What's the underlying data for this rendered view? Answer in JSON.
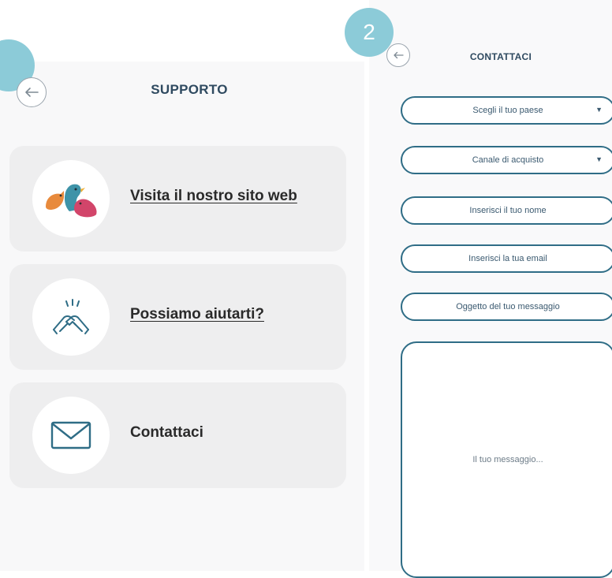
{
  "steps": {
    "step2": "2"
  },
  "support_screen": {
    "title": "SUPPORTO",
    "cards": [
      {
        "label": "Visita il nostro sito web",
        "icon": "birds-logo-icon"
      },
      {
        "label": "Possiamo aiutarti?",
        "icon": "handshake-icon"
      },
      {
        "label": "Contattaci",
        "icon": "envelope-icon"
      }
    ]
  },
  "contact_screen": {
    "title": "CONTATTACI",
    "fields": {
      "country": "Scegli il tuo paese",
      "channel": "Canale di acquisto",
      "name": "Inserisci il tuo nome",
      "email": "Inserisci la tua email",
      "subject": "Oggetto del tuo messaggio",
      "message": "Il tuo messaggio..."
    },
    "dropdown_caret": "▼"
  },
  "colors": {
    "accent": "#8ccbd8",
    "border": "#2f6d86",
    "title": "#2f4a60",
    "card_bg": "#eeeeef"
  }
}
